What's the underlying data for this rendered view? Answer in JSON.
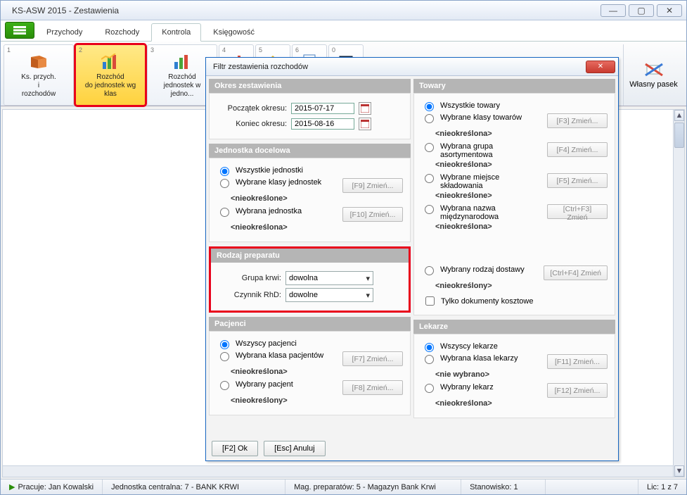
{
  "window_title": "KS-ASW 2015 - Zestawienia",
  "tabs": {
    "t1": "Przychody",
    "t2": "Rozchody",
    "t3": "Kontrola",
    "t4": "Księgowość"
  },
  "ribbon": {
    "i1": "Ks. przych.\ni\nrozchodów",
    "i2": "Rozchód\ndo jednostek wg\nklas",
    "i3": "Rozchód\njednostek w\njedno...",
    "right": "Własny pasek"
  },
  "dialog": {
    "title": "Filtr zestawienia rozchodów",
    "okres": {
      "head": "Okres zestawienia",
      "start_label": "Początek okresu:",
      "start": "2015-07-17",
      "end_label": "Koniec okresu:",
      "end": "2015-08-16"
    },
    "jednostka": {
      "head": "Jednostka docelowa",
      "r1": "Wszystkie jednostki",
      "r2": "Wybrane klasy jednostek",
      "r2s": "<nieokreślone>",
      "r2b": "[F9] Zmień...",
      "r3": "Wybrana jednostka",
      "r3s": "<nieokreślona>",
      "r3b": "[F10] Zmień..."
    },
    "rodzaj": {
      "head": "Rodzaj preparatu",
      "l1": "Grupa krwi:",
      "v1": "dowolna",
      "l2": "Czynnik RhD:",
      "v2": "dowolne"
    },
    "pacjenci": {
      "head": "Pacjenci",
      "r1": "Wszyscy pacjenci",
      "r2": "Wybrana klasa pacjentów",
      "r2s": "<nieokreślona>",
      "r2b": "[F7] Zmień...",
      "r3": "Wybrany pacjent",
      "r3s": "<nieokreślony>",
      "r3b": "[F8] Zmień..."
    },
    "towary": {
      "head": "Towary",
      "r1": "Wszystkie towary",
      "r2": "Wybrane klasy towarów",
      "r2s": "<nieokreślona>",
      "r2b": "[F3] Zmień...",
      "r3": "Wybrana grupa asortymentowa",
      "r3s": "<nieokreślona>",
      "r3b": "[F4] Zmień...",
      "r4": "Wybrane miejsce składowania",
      "r4s": "<nieokreślone>",
      "r4b": "[F5] Zmień...",
      "r5": "Wybrana nazwa międzynarodowa",
      "r5s": "<nieokreślona>",
      "r5b": "[Ctrl+F3] Zmień",
      "r6": "Wybrany rodzaj dostawy",
      "r6s": "<nieokreślony>",
      "r6b": "[Ctrl+F4] Zmień",
      "chk": "Tylko dokumenty kosztowe"
    },
    "lekarze": {
      "head": "Lekarze",
      "r1": "Wszyscy lekarze",
      "r2": "Wybrana klasa lekarzy",
      "r2s": "<nie wybrano>",
      "r2b": "[F11] Zmień...",
      "r3": "Wybrany lekarz",
      "r3s": "<nieokreślona>",
      "r3b": "[F12] Zmień..."
    },
    "ok": "[F2] Ok",
    "cancel": "[Esc] Anuluj"
  },
  "status": {
    "s1": "Pracuje: Jan Kowalski",
    "s2": "Jednostka centralna: 7 - BANK KRWI",
    "s3": "Mag. preparatów:  5 - Magazyn Bank Krwi",
    "s4": "Stanowisko: 1",
    "s5": "Lic: 1 z 7"
  }
}
